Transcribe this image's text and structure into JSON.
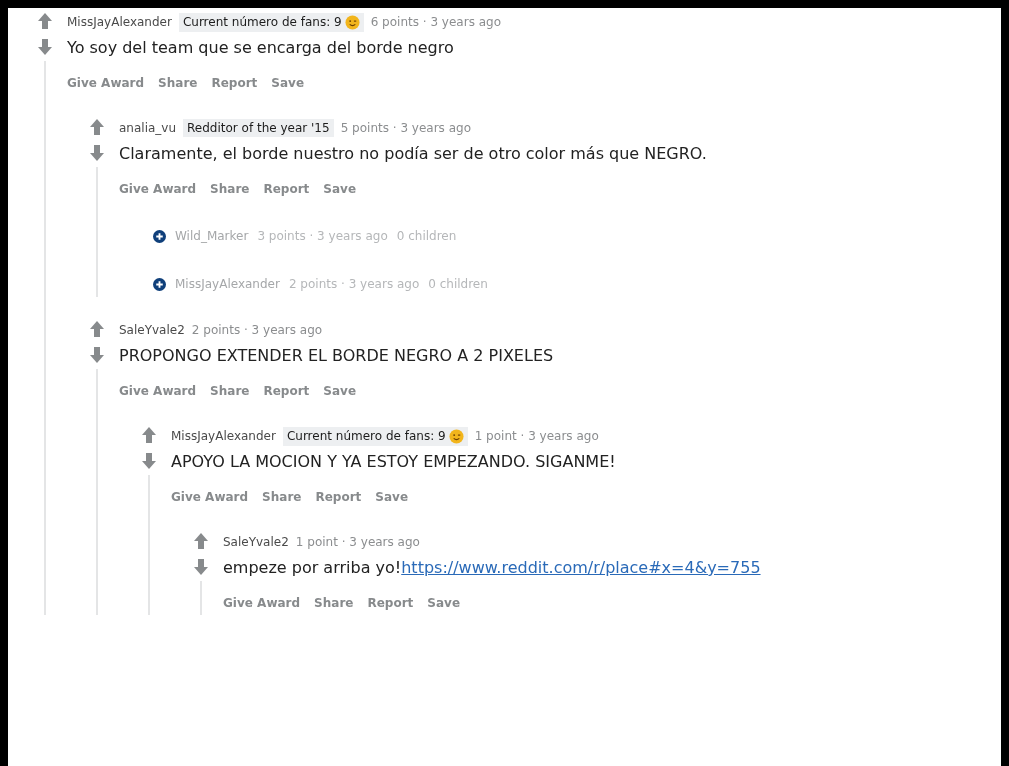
{
  "comments": [
    {
      "kind": "comment",
      "author": "MissJayAlexander",
      "flair": {
        "text": "Current número de fans: 9",
        "emoji": true
      },
      "meta": "6 points · 3 years ago",
      "body": "Yo soy del team que se encarga del borde negro",
      "actions": [
        "Give Award",
        "Share",
        "Report",
        "Save"
      ],
      "children": [
        {
          "kind": "comment",
          "author": "analia_vu",
          "flair": {
            "text": "Redditor of the year '15",
            "emoji": false
          },
          "meta": "5 points · 3 years ago",
          "body": "Claramente, el borde nuestro no podía ser de otro color más que NEGRO.",
          "actions": [
            "Give Award",
            "Share",
            "Report",
            "Save"
          ],
          "children": [
            {
              "kind": "collapsed",
              "author": "Wild_Marker",
              "meta": "3 points · 3 years ago",
              "count": "0 children"
            },
            {
              "kind": "collapsed",
              "author": "MissJayAlexander",
              "meta": "2 points · 3 years ago",
              "count": "0 children"
            }
          ]
        },
        {
          "kind": "comment",
          "author": "SaleYvale2",
          "meta": "2 points · 3 years ago",
          "body": "PROPONGO EXTENDER EL BORDE NEGRO A 2 PIXELES",
          "actions": [
            "Give Award",
            "Share",
            "Report",
            "Save"
          ],
          "children": [
            {
              "kind": "comment",
              "author": "MissJayAlexander",
              "flair": {
                "text": "Current número de fans: 9",
                "emoji": true
              },
              "meta": "1 point · 3 years ago",
              "body": "APOYO LA MOCION Y YA ESTOY EMPEZANDO. SIGANME!",
              "actions": [
                "Give Award",
                "Share",
                "Report",
                "Save"
              ],
              "children": [
                {
                  "kind": "comment",
                  "author": "SaleYvale2",
                  "meta": "1 point · 3 years ago",
                  "body": "empeze por arriba yo!",
                  "link": "https://www.reddit.com/r/place#x=4&y=755",
                  "actions": [
                    "Give Award",
                    "Share",
                    "Report",
                    "Save"
                  ]
                }
              ]
            }
          ]
        }
      ]
    }
  ]
}
